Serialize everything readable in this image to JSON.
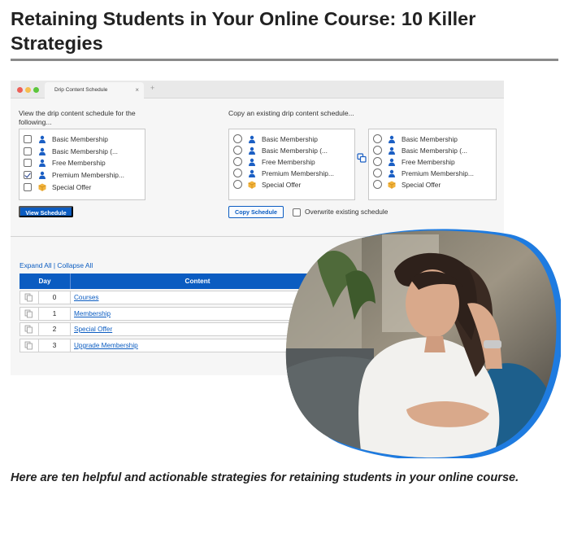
{
  "article": {
    "title": "Retaining Students in Your Online Course: 10 Killer Strategies",
    "intro": "Here are ten helpful and actionable strategies for retaining students in your online course."
  },
  "window": {
    "tab_label": "Drip Content Schedule",
    "tab_close": "×",
    "tab_add": "+"
  },
  "view_panel": {
    "label": "View the drip content schedule for the following...",
    "items": [
      {
        "label": "Basic Membership",
        "icon": "user-icon",
        "checked": false
      },
      {
        "label": "Basic Membership (...",
        "icon": "user-icon",
        "checked": false
      },
      {
        "label": "Free Membership",
        "icon": "user-icon",
        "checked": false
      },
      {
        "label": "Premium Membership...",
        "icon": "user-icon",
        "checked": true
      },
      {
        "label": "Special Offer",
        "icon": "package-icon",
        "checked": false
      }
    ],
    "button": "View Schedule"
  },
  "copy_panel": {
    "label": "Copy an existing drip content schedule...",
    "source_items": [
      {
        "label": "Basic Membership",
        "icon": "user-icon"
      },
      {
        "label": "Basic Membership (...",
        "icon": "user-icon"
      },
      {
        "label": "Free Membership",
        "icon": "user-icon"
      },
      {
        "label": "Premium Membership...",
        "icon": "user-icon"
      },
      {
        "label": "Special Offer",
        "icon": "package-icon"
      }
    ],
    "target_items": [
      {
        "label": "Basic Membership",
        "icon": "user-icon"
      },
      {
        "label": "Basic Membership (...",
        "icon": "user-icon"
      },
      {
        "label": "Free Membership",
        "icon": "user-icon"
      },
      {
        "label": "Premium Membership...",
        "icon": "user-icon"
      },
      {
        "label": "Special Offer",
        "icon": "package-icon"
      }
    ],
    "button": "Copy Schedule",
    "overwrite_label": "Overwrite existing schedule",
    "overwrite_checked": false
  },
  "schedule": {
    "expand_all": "Expand All",
    "separator": "|",
    "collapse_all": "Collapse All",
    "headers": {
      "day": "Day",
      "content": "Content"
    },
    "rows": [
      {
        "day": "0",
        "content": "Courses"
      },
      {
        "day": "1",
        "content": "Membership"
      },
      {
        "day": "2",
        "content": "Special Offer"
      },
      {
        "day": "3",
        "content": "Upgrade Membership"
      }
    ]
  },
  "colors": {
    "accent": "#0b5cc1",
    "blob_outline": "#1e7be0",
    "package": "#f2b33d"
  }
}
